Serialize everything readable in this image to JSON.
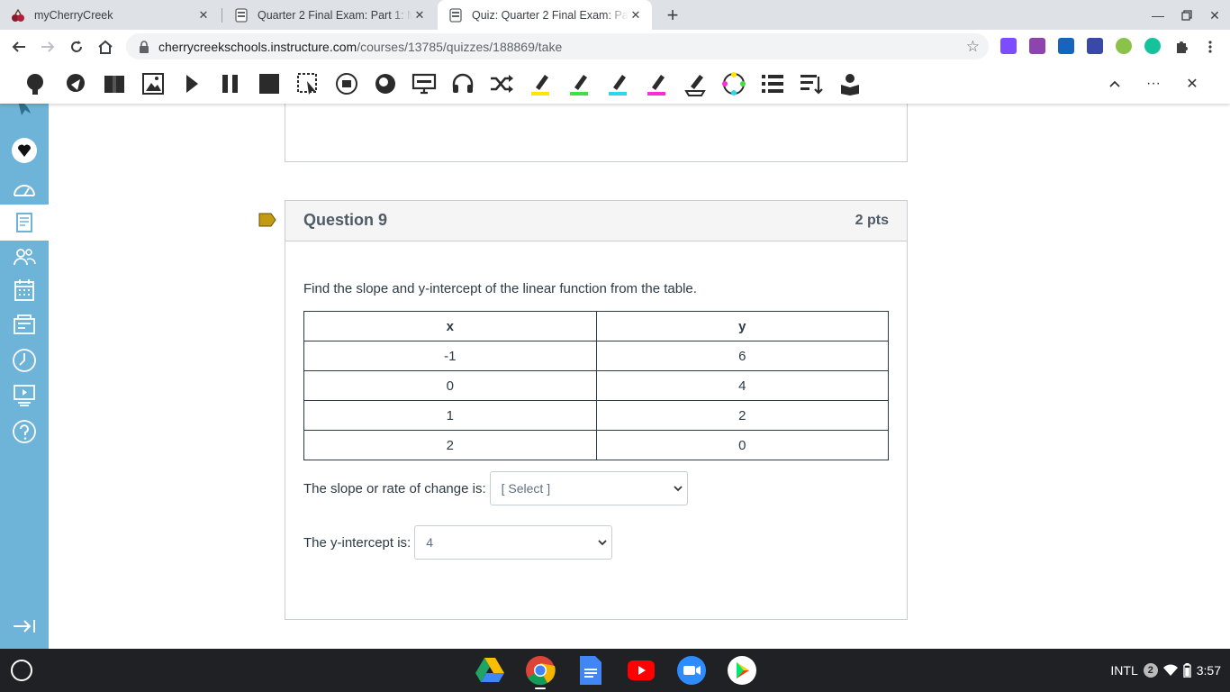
{
  "browser": {
    "tabs": [
      {
        "title": "myCherryCreek",
        "active": false
      },
      {
        "title": "Quarter 2 Final Exam: Part 1: Ma",
        "active": false
      },
      {
        "title": "Quiz: Quarter 2 Final Exam: Part",
        "active": true
      }
    ],
    "url_host": "cherrycreekschools.instructure.com",
    "url_path": "/courses/13785/quizzes/188869/take"
  },
  "quiz": {
    "question_title": "Question 9",
    "points": "2 pts",
    "prompt": "Find the slope and y-intercept of the linear function from the table.",
    "table": {
      "headers": [
        "x",
        "y"
      ],
      "rows": [
        [
          "-1",
          "6"
        ],
        [
          "0",
          "4"
        ],
        [
          "1",
          "2"
        ],
        [
          "2",
          "0"
        ]
      ]
    },
    "slope": {
      "label": "The slope or rate of change is:",
      "selected": "[ Select ]"
    },
    "intercept": {
      "label": "The y-intercept is:",
      "selected": "4"
    }
  },
  "shelf": {
    "ime": "INTL",
    "notifications": "2",
    "time": "3:57"
  },
  "colors": {
    "canvas_nav": "#6eb4d8",
    "flag": "#c39a12",
    "shelf": "#202124"
  }
}
